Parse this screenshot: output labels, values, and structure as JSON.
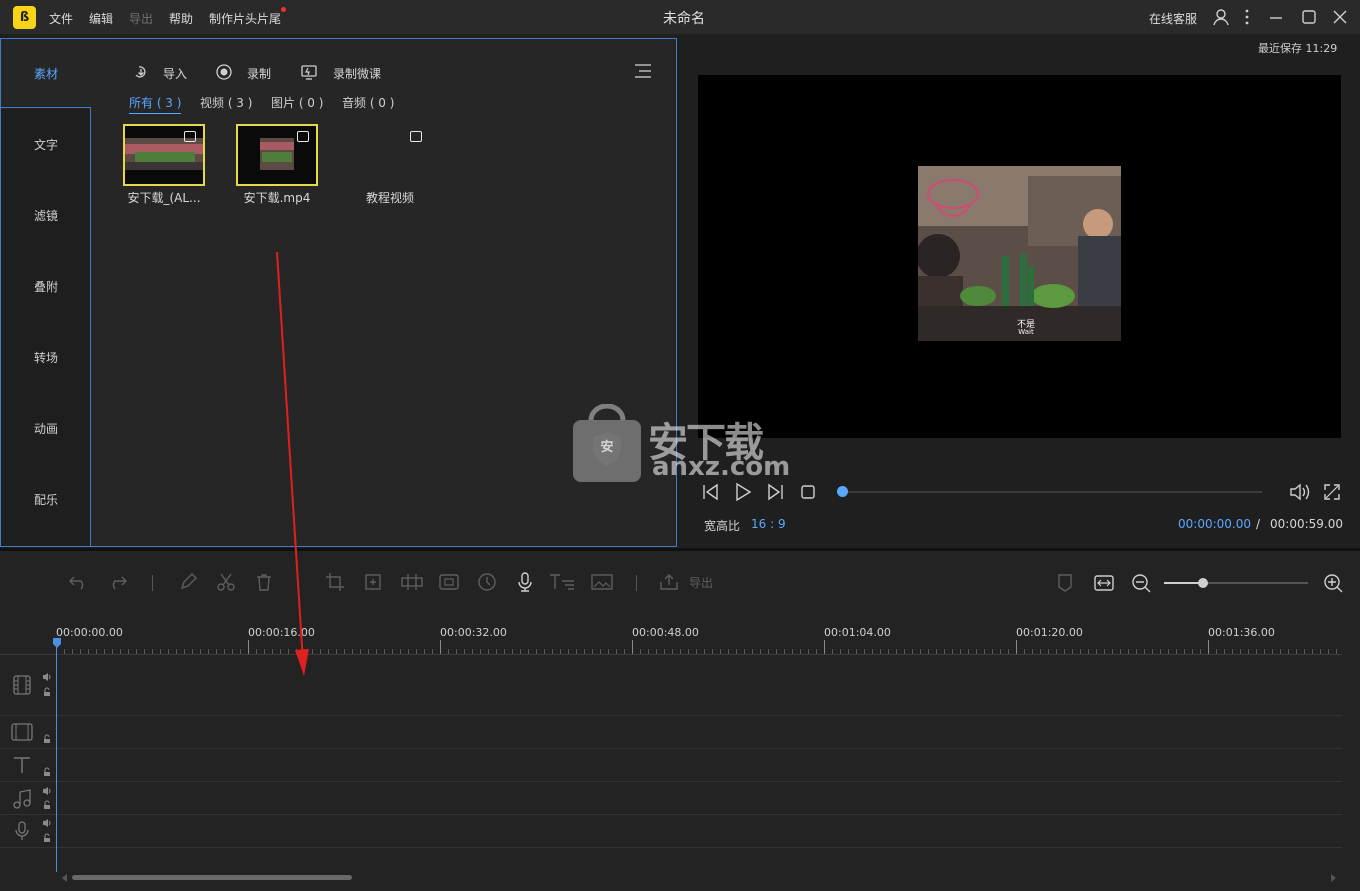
{
  "app": {
    "logo_glyph": "ß",
    "title": "未命名",
    "menu": [
      "文件",
      "编辑",
      "导出",
      "帮助",
      "制作片头片尾"
    ],
    "support_label": "在线客服"
  },
  "side_tabs": [
    "素材",
    "文字",
    "滤镜",
    "叠附",
    "转场",
    "动画",
    "配乐"
  ],
  "media_toolbar": {
    "import_label": "导入",
    "record_label": "录制",
    "record_course_label": "录制微课"
  },
  "filter_tabs": [
    "所有 ( 3 )",
    "视频 ( 3 )",
    "图片 ( 0 )",
    "音频 ( 0 )"
  ],
  "media_items": [
    {
      "name": "安下载_(AL..."
    },
    {
      "name": "安下载.mp4"
    },
    {
      "name": "教程视频"
    }
  ],
  "preview": {
    "last_saved": "最近保存 11:29",
    "subtitle_cn": "不是",
    "subtitle_en": "Wait",
    "aspect_label": "宽高比",
    "aspect_value": "16 : 9",
    "current_time": "00:00:00.00",
    "time_separator": "/",
    "total_time": "00:00:59.00",
    "playback_progress": 0
  },
  "watermark": {
    "badge_glyph": "安",
    "title": "安下载",
    "domain": "anxz.com"
  },
  "timeline": {
    "export_label": "导出",
    "ruler": [
      "00:00:00.00",
      "00:00:16.00",
      "00:00:32.00",
      "00:00:48.00",
      "00:01:04.00",
      "00:01:20.00",
      "00:01:36.00"
    ],
    "zoom_level": 0.27
  },
  "colors": {
    "accent": "#5aa7ff",
    "thumb_border": "#e3d94a",
    "arrow": "#e02020"
  }
}
